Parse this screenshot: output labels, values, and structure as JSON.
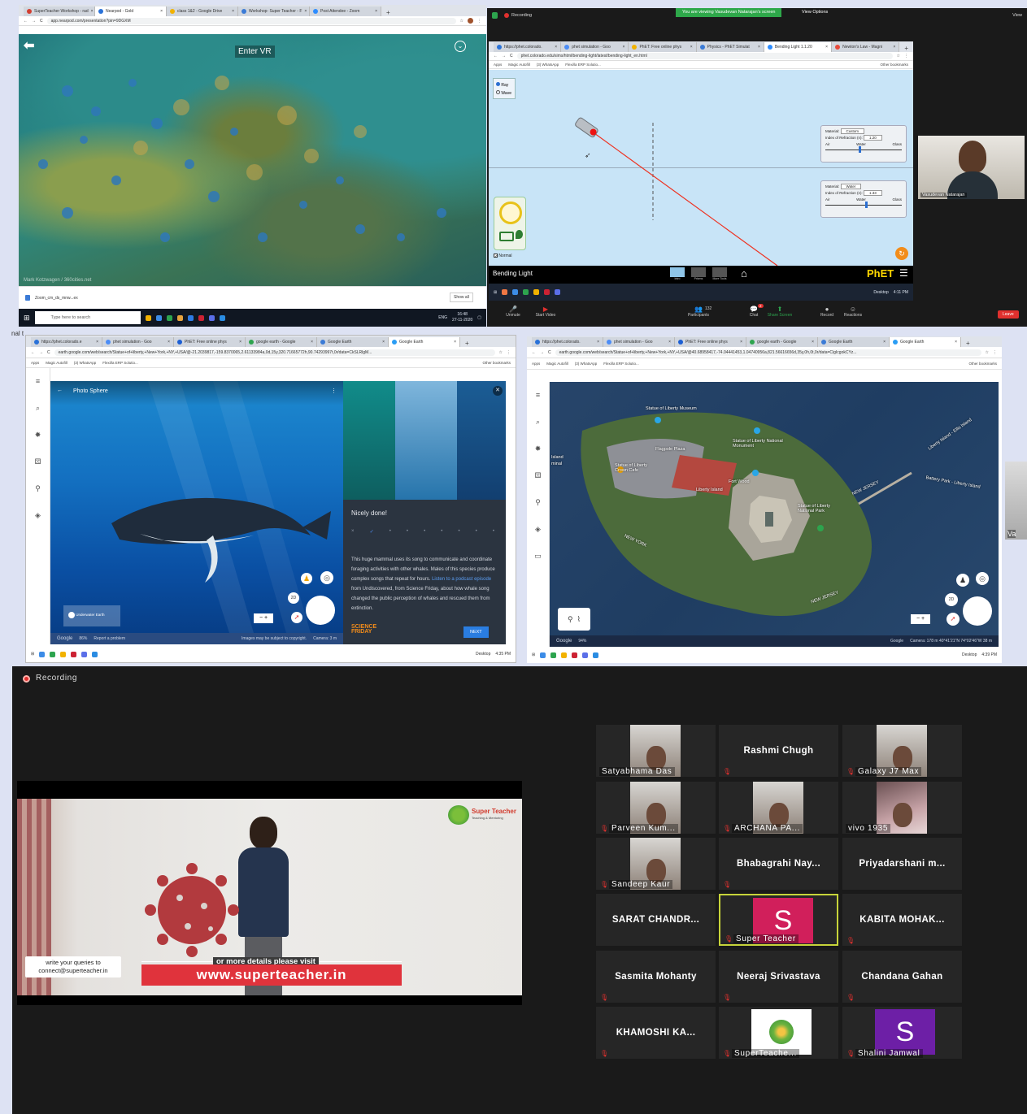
{
  "panel1": {
    "tabs": [
      "SuperTeacher Workshop - rad",
      "Nearpod - Gold",
      "class 1&2 - Google Drive",
      "Workshop- Super Teacher - F",
      "Post Attendee - Zoom"
    ],
    "url": "app.nearpod.com/presentation?pin=9DGXM",
    "enter_vr": "Enter VR",
    "credit": "Mark Kotzwagen / 360cities.net",
    "download_file": "Zoom_cm_ds_mnw...ex",
    "show_all": "Show all",
    "search_placeholder": "Type here to search",
    "clock_time": "16:48",
    "clock_date": "27-11-2020",
    "lang": "ENG"
  },
  "panel2": {
    "recording": "Recording",
    "viewing_banner": "You are viewing Vasudevan Natarajan's screen",
    "view_options": "View Options",
    "view": "View",
    "tabs": [
      "https://phet.colorado.",
      "phet simulation - Goo",
      "PhET: Free online phys",
      "Physics - PhET Simulat",
      "Bending Light 1.1.20",
      "Newton's Law - Magni"
    ],
    "url": "phet.colorado.edu/sims/html/bending-light/latest/bending-light_en.html",
    "bookmarks": [
      "Apps",
      "Magic Autofill",
      "(3) WhatsApp",
      "Flexi/la ERP Solutio..."
    ],
    "other_bookmarks": "Other bookmarks",
    "ray_label": "Ray",
    "wave_label": "Wave",
    "material_label": "Material:",
    "material_top": "Custom",
    "material_bottom": "Water",
    "index_label": "Index of Refraction (n):",
    "index_top": "1.20",
    "index_bottom": "1.33",
    "air_label": "Air",
    "water_label": "Water",
    "glass_label": "Glass",
    "normal_label": "Normal",
    "sim_title": "Bending Light",
    "screens": [
      "Intro",
      "Prisms",
      "More Tools"
    ],
    "phet": "PhET",
    "participant_name": "Vasudevan Natarajan",
    "controls": [
      "Unmute",
      "Start Video",
      "Participants",
      "Chat",
      "Share Screen",
      "Record",
      "Reactions"
    ],
    "participant_count": "132",
    "chat_badge": "2",
    "leave": "Leave",
    "clock": "4:11 PM",
    "desktop": "Desktop"
  },
  "panel3": {
    "tabs": [
      "https://phet.colorado.e",
      "phet simulation - Goo",
      "PhET: Free online phys",
      "google earth - Google",
      "Google Earth",
      "Google Earth"
    ],
    "url": "earth.google.com/web/search/Statue+of+liberty,+New+York,+NY,+USA/@-21.2039817,-159.8370065,2.61133984a,0d,15y,320.71665772h,90.74293997t,0r/data=CkSLRlgM...",
    "bookmarks": [
      "Apps",
      "Magic Autofill",
      "(3) WhatsApp",
      "Flexi/la ERP Solutio..."
    ],
    "other_bookmarks": "Other bookmarks",
    "photo_sphere": "Photo Sphere",
    "nicely_done": "Nicely done!",
    "body_pre": "This huge mammal uses its song to communicate and coordinate foraging activities with other whales. Males of this species produce complex songs that repeat for hours.",
    "body_link": "Listen to a podcast episode",
    "body_post": "from Undiscovered, from Science Friday, about how whale song changed the public perception of whales and rescued them from extinction.",
    "science": "SCIENCE",
    "friday": "FRIDAY",
    "next": "NEXT",
    "underwater_earth": "Underwater Earth",
    "google": "Google",
    "percent": "86%",
    "report": "Report a problem",
    "copyright": "Images may be subject to copyright.",
    "camera": "Camera: 3 m",
    "btn_2d": "2D",
    "clock": "4:35 PM",
    "desktop": "Desktop"
  },
  "panel4": {
    "tabs": [
      "https://phet.colorado.",
      "phet simulation - Goo",
      "PhET: Free online phys",
      "google earth - Google",
      "Google Earth",
      "Google Earth"
    ],
    "url": "earth.google.com/web/search/Statue+of+liberty,+New+York,+NY,+USA/@40.68958417,-74.04441453,1.04740956a,821.56616656d,35y,0h,0t,0r/data=CigIcgokCYz...",
    "bookmarks": [
      "Apps",
      "Magic Autofill",
      "(3) WhatsApp",
      "Flexi/la ERP Solutio..."
    ],
    "other_bookmarks": "Other bookmarks",
    "labels": [
      "Statue of Liberty Museum",
      "Flagpole Plaza",
      "Statue of Liberty National Monument",
      "Statue of Liberty Crown Cafe",
      "Liberty Island",
      "Fort Wood",
      "Statue of Liberty National Park",
      "NEW JERSEY",
      "NEW YORK",
      "Liberty Island - Ellis Island",
      "Battery Park - Liberty Island",
      "NEW JERSEY",
      "Island",
      "minal"
    ],
    "google": "Google",
    "percent": "94%",
    "attrib": "Google",
    "camera": "Camera: 178 m  40°41'21\"N 74°02'46\"W  38 m",
    "btn_2d": "2D",
    "clock": "4:39 PM",
    "desktop": "Desktop",
    "edge_label": "Va"
  },
  "panel5": {
    "recording": "Recording",
    "logo": "Super Teacher",
    "logo_tag": "Teaching & Mentoring",
    "queries": "write your queries to\nconnect@superteacher.in",
    "visit": "or more details please visit",
    "website": "www.superteacher.in",
    "participants": [
      {
        "name": "Satyabhama Das",
        "type": "video",
        "muted": false
      },
      {
        "name": "Rashmi Chugh",
        "type": "name",
        "muted": true
      },
      {
        "name": "Galaxy J7 Max",
        "type": "video",
        "muted": true
      },
      {
        "name": "Parveen Kum...",
        "type": "video",
        "muted": true
      },
      {
        "name": "ARCHANA PA...",
        "type": "video",
        "muted": true
      },
      {
        "name": "vivo 1935",
        "type": "video",
        "muted": false
      },
      {
        "name": "Sandeep Kaur",
        "type": "video",
        "muted": true
      },
      {
        "name": "Bhabagrahi Nay...",
        "type": "name",
        "muted": true
      },
      {
        "name": "Priyadarshani m...",
        "type": "name",
        "muted": false
      },
      {
        "name": "SARAT CHANDR...",
        "type": "name",
        "muted": false
      },
      {
        "name": "Super Teacher",
        "type": "avatar",
        "letter": "S",
        "color": "#d11f5b",
        "muted": true,
        "active": true
      },
      {
        "name": "KABITA MOHAK...",
        "type": "name",
        "muted": true
      },
      {
        "name": "Sasmita Mohanty",
        "type": "name",
        "muted": true
      },
      {
        "name": "Neeraj Srivastava",
        "type": "name",
        "muted": true
      },
      {
        "name": "Chandana Gahan",
        "type": "name",
        "muted": true
      },
      {
        "name": "KHAMOSHI KA...",
        "type": "name",
        "muted": true
      },
      {
        "name": "SuperTeache...",
        "type": "logo",
        "muted": true
      },
      {
        "name": "Shalini Jamwal",
        "type": "avatar",
        "letter": "S",
        "color": "#6d1fa6",
        "muted": true
      }
    ]
  },
  "edge_text": "nal t"
}
